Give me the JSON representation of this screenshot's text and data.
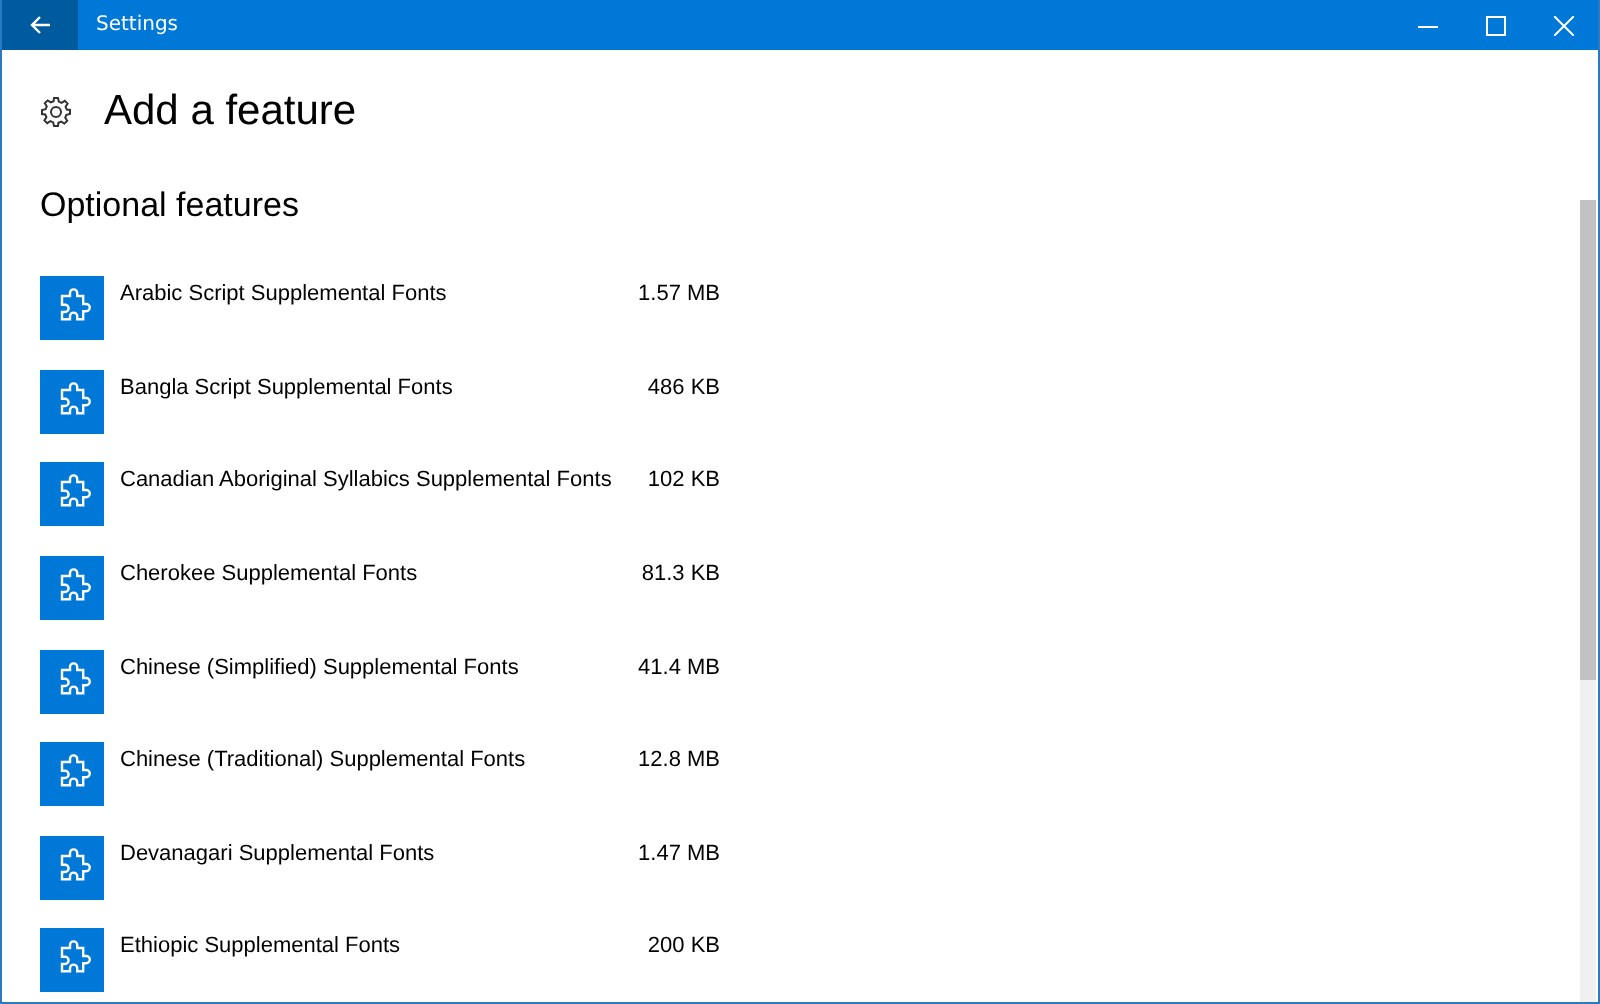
{
  "window": {
    "title": "Settings"
  },
  "page": {
    "title": "Add a feature"
  },
  "section": {
    "title": "Optional features"
  },
  "features": [
    {
      "name": "Arabic Script Supplemental Fonts",
      "size": "1.57 MB"
    },
    {
      "name": "Bangla Script Supplemental Fonts",
      "size": "486 KB"
    },
    {
      "name": "Canadian Aboriginal Syllabics Supplemental Fonts",
      "size": "102 KB"
    },
    {
      "name": "Cherokee Supplemental Fonts",
      "size": "81.3 KB"
    },
    {
      "name": "Chinese (Simplified) Supplemental Fonts",
      "size": "41.4 MB"
    },
    {
      "name": "Chinese (Traditional) Supplemental Fonts",
      "size": "12.8 MB"
    },
    {
      "name": "Devanagari Supplemental Fonts",
      "size": "1.47 MB"
    },
    {
      "name": "Ethiopic Supplemental Fonts",
      "size": "200 KB"
    }
  ]
}
